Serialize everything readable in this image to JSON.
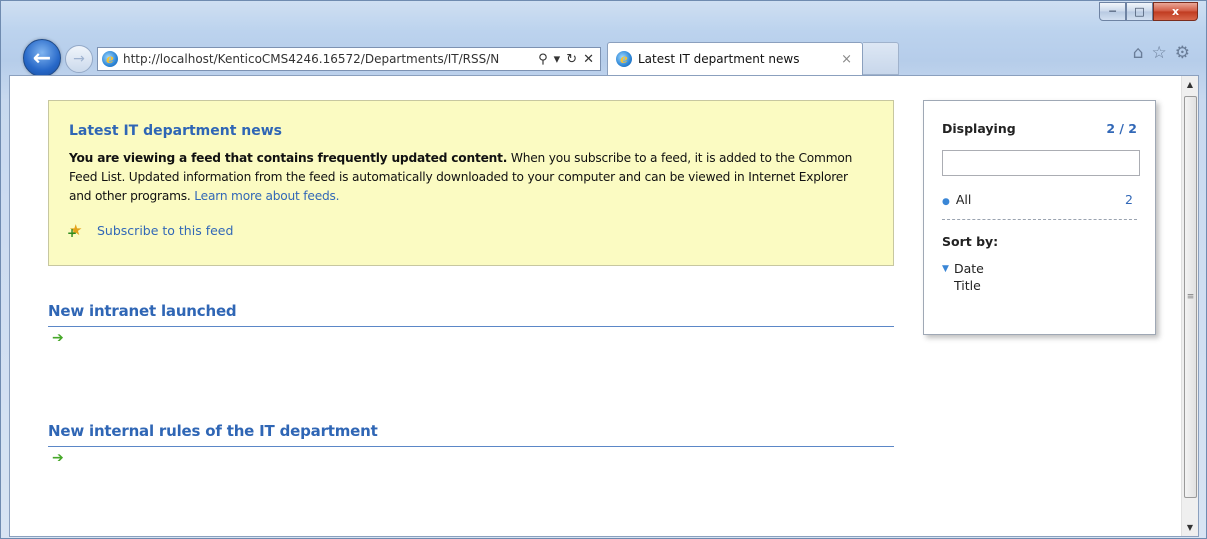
{
  "browser": {
    "url": "http://localhost/KenticoCMS4246.16572/Departments/IT/RSS/N",
    "tab_title": "Latest IT department news",
    "tab_close": "×",
    "window_controls": {
      "minimize": "─",
      "maximize": "□",
      "close": "x"
    }
  },
  "feed": {
    "title": "Latest IT department news",
    "notice_bold": "You are viewing a feed that contains frequently updated content.",
    "notice_text": " When you subscribe to a feed, it is added to the Common Feed List. Updated information from the feed is automatically downloaded to your computer and can be viewed in Internet Explorer and other programs. ",
    "learn_more": "Learn more about feeds.",
    "subscribe": "Subscribe to this feed"
  },
  "articles": [
    {
      "title": "New intranet launched"
    },
    {
      "title": "New internal rules of the IT department"
    }
  ],
  "sidebar": {
    "displaying_label": "Displaying",
    "displaying_count": "2 / 2",
    "filter_value": "",
    "all_label": "All",
    "all_count": "2",
    "sort_label": "Sort by:",
    "sort_options": [
      "Date",
      "Title"
    ]
  }
}
